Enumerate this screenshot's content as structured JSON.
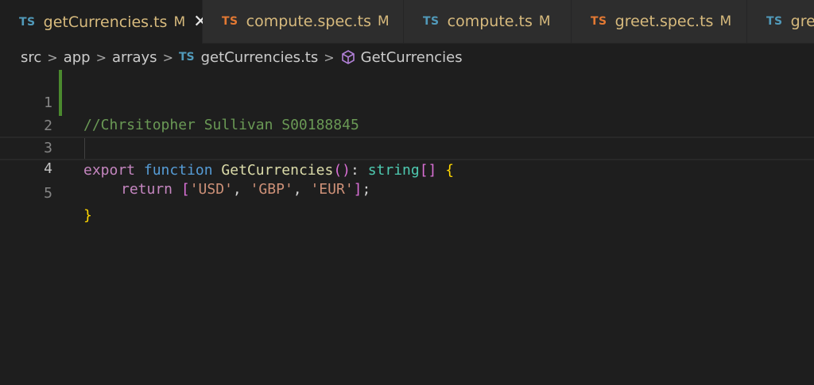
{
  "tabs": [
    {
      "badge": "TS",
      "label": "getCurrencies.ts",
      "modified": "M",
      "active": true,
      "close": "✕",
      "badge_color": "#519aba"
    },
    {
      "badge": "TS",
      "label": "compute.spec.ts",
      "modified": "M",
      "active": false,
      "badge_color": "#e37933"
    },
    {
      "badge": "TS",
      "label": "compute.ts",
      "modified": "M",
      "active": false,
      "badge_color": "#519aba"
    },
    {
      "badge": "TS",
      "label": "greet.spec.ts",
      "modified": "M",
      "active": false,
      "badge_color": "#e37933"
    },
    {
      "badge": "TS",
      "label": "gree",
      "modified": "",
      "active": false,
      "badge_color": "#519aba"
    }
  ],
  "breadcrumb": {
    "items": [
      "src",
      "app",
      "arrays"
    ],
    "file_badge": "TS",
    "file": "getCurrencies.ts",
    "symbol_icon": "symbol-function-icon",
    "symbol": "GetCurrencies",
    "separator": ">"
  },
  "editor": {
    "lines": [
      {
        "num": "1",
        "text": "//Chrsitopher Sullivan S00188845"
      },
      {
        "num": "2",
        "text": ""
      },
      {
        "num": "3",
        "kw": "export",
        "kw2": "function",
        "fn": "GetCurrencies",
        "parens": "()",
        "colon": ": ",
        "type": "string",
        "brackets": "[]",
        "brace": "{"
      },
      {
        "num": "4",
        "ret": "return",
        "open": "[",
        "s1": "'USD'",
        "s2": "'GBP'",
        "s3": "'EUR'",
        "close": "]",
        "semi": ";",
        "comma": ", "
      },
      {
        "num": "5",
        "brace": "}"
      }
    ],
    "active_line": "4",
    "colors": {
      "comment": "#6a9955",
      "keyword": "#c586c0",
      "function": "#dcdcaa",
      "type": "#4ec9b0",
      "string": "#ce9178",
      "git_added": "#4b8a2e"
    }
  }
}
